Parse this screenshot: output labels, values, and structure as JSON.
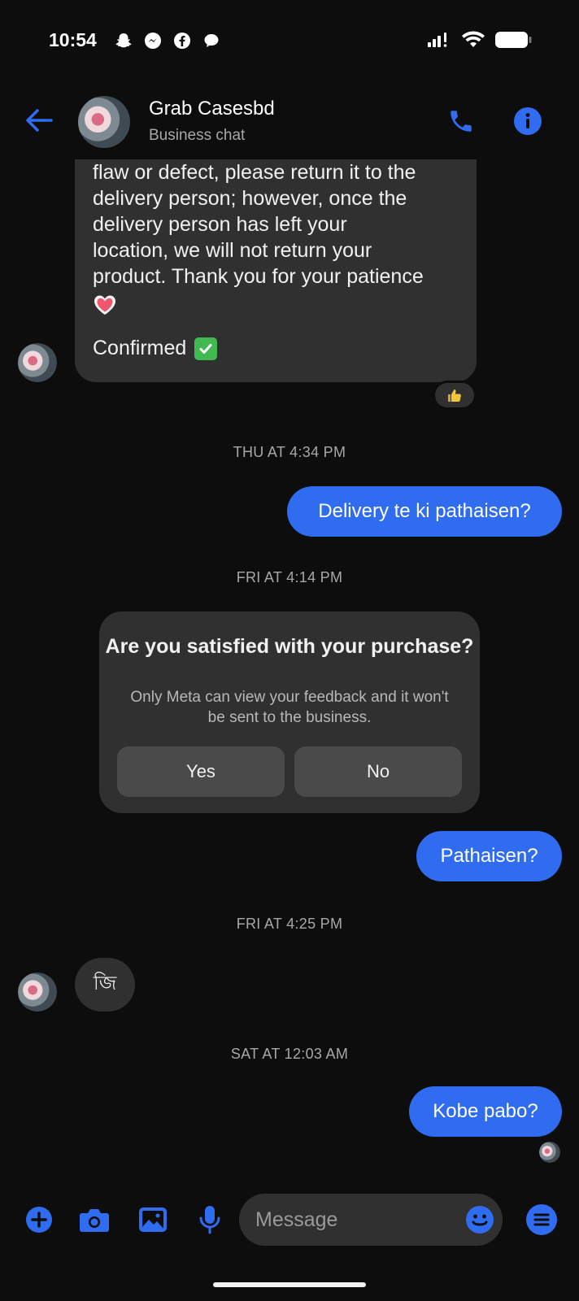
{
  "status_bar": {
    "time": "10:54",
    "app_icons": [
      "snapchat-icon",
      "messenger-icon",
      "facebook-icon",
      "chat-bubble-icon"
    ],
    "right_icons": [
      "signal-icon",
      "wifi-icon",
      "battery-icon"
    ]
  },
  "header": {
    "title": "Grab Casesbd",
    "subtitle": "Business chat"
  },
  "messages": {
    "incoming_long": {
      "text": "flaw or defect, please return it to the\ndelivery person; however, once the\ndelivery person has left your\nlocation, we will not return your\nproduct. Thank you for your patience",
      "heart": "❤️",
      "confirmed": "Confirmed",
      "check": "✔"
    },
    "reaction": "👍",
    "ts1": "THU AT 4:34 PM",
    "out1": "Delivery te ki pathaisen?",
    "ts2": "FRI AT 4:14 PM",
    "survey": {
      "title": "Are you satisfied with your purchase?",
      "note": "Only Meta can view your feedback and it won't be sent to the business.",
      "yes": "Yes",
      "no": "No"
    },
    "out2": "Pathaisen?",
    "ts3": "FRI AT 4:25 PM",
    "incoming_short": "জি",
    "ts4": "SAT AT 12:03 AM",
    "out3": "Kobe pabo?"
  },
  "composer": {
    "placeholder": "Message"
  },
  "colors": {
    "accent": "#2f6cf0",
    "bubble_in": "#303030",
    "background": "#0d0d0d"
  }
}
